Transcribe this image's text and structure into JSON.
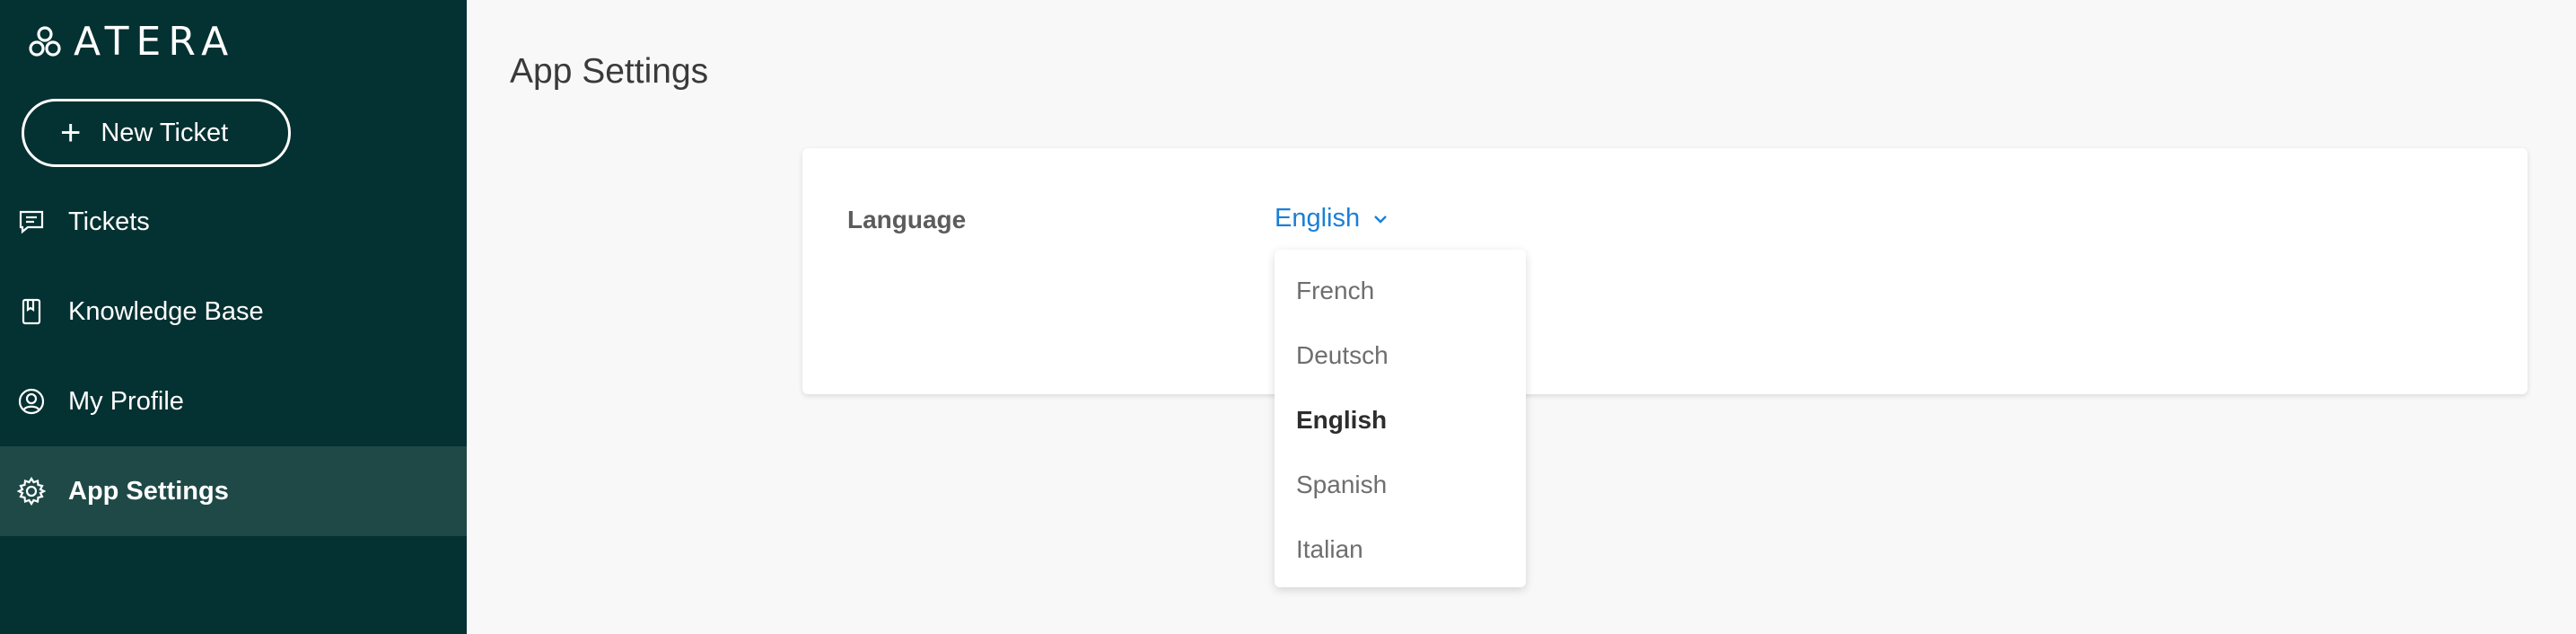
{
  "sidebar": {
    "logo_text": "ATERA",
    "new_ticket_label": "New Ticket",
    "items": [
      {
        "label": "Tickets",
        "icon": "ticket-icon"
      },
      {
        "label": "Knowledge Base",
        "icon": "book-icon"
      },
      {
        "label": "My Profile",
        "icon": "user-circle-icon"
      },
      {
        "label": "App Settings",
        "icon": "gear-icon",
        "active": true
      }
    ]
  },
  "main": {
    "title": "App Settings",
    "language": {
      "label": "Language",
      "selected": "English",
      "options": [
        "French",
        "Deutsch",
        "English",
        "Spanish",
        "Italian"
      ]
    }
  },
  "colors": {
    "sidebar_bg": "#043131",
    "sidebar_active_bg": "#1e4947",
    "accent_blue": "#1a7fd6",
    "page_bg": "#f8f8f8"
  }
}
